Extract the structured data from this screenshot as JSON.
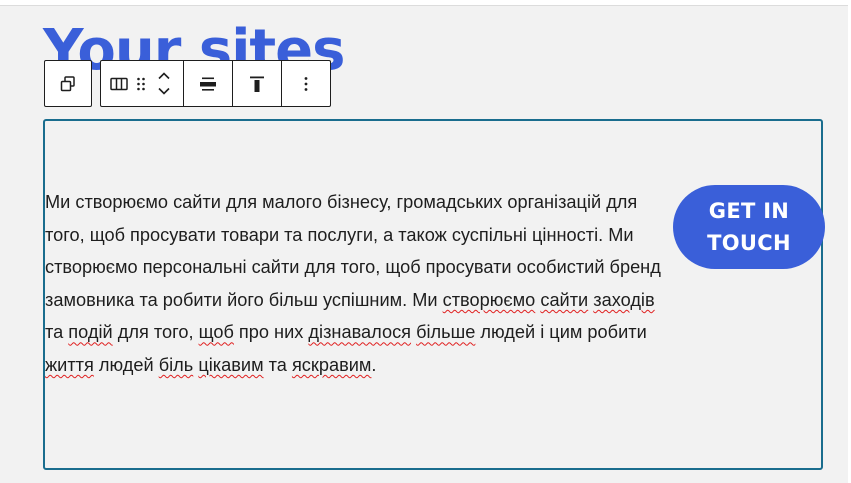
{
  "page": {
    "heading": "Your sites"
  },
  "toolbar": {
    "parent_icon": "parent-block-icon",
    "block_type_icon": "columns-icon",
    "drag_icon": "drag-handle-icon",
    "move_up_icon": "chevron-up-icon",
    "move_down_icon": "chevron-down-icon",
    "align_icon": "align-center-icon",
    "vertical_align_icon": "vertical-align-top-icon",
    "options_icon": "more-vertical-icon"
  },
  "block": {
    "paragraph_parts": [
      "Ми створюємо сайти для малого бізнесу, громадських організацій для того, щоб просувати товари та послуги, а також суспільні цінності. Ми створюємо персональні сайти для того, щоб просувати особистий бренд замовника та робити його більш успішним. Ми ",
      "створюємо",
      " ",
      "сайти",
      " ",
      "заходів",
      " та ",
      "подій",
      " для того, ",
      "щоб",
      " про них ",
      "дізнавалося",
      " ",
      "більше",
      " людей і цим робити ",
      "життя",
      " людей ",
      "біль",
      " ",
      "цікавим",
      " та ",
      "яскравим",
      "."
    ],
    "button_label": "GET IN TOUCH"
  },
  "colors": {
    "accent": "#3a5fd9",
    "selection_border": "#1a6d8e",
    "spellcheck": "#e02020"
  }
}
